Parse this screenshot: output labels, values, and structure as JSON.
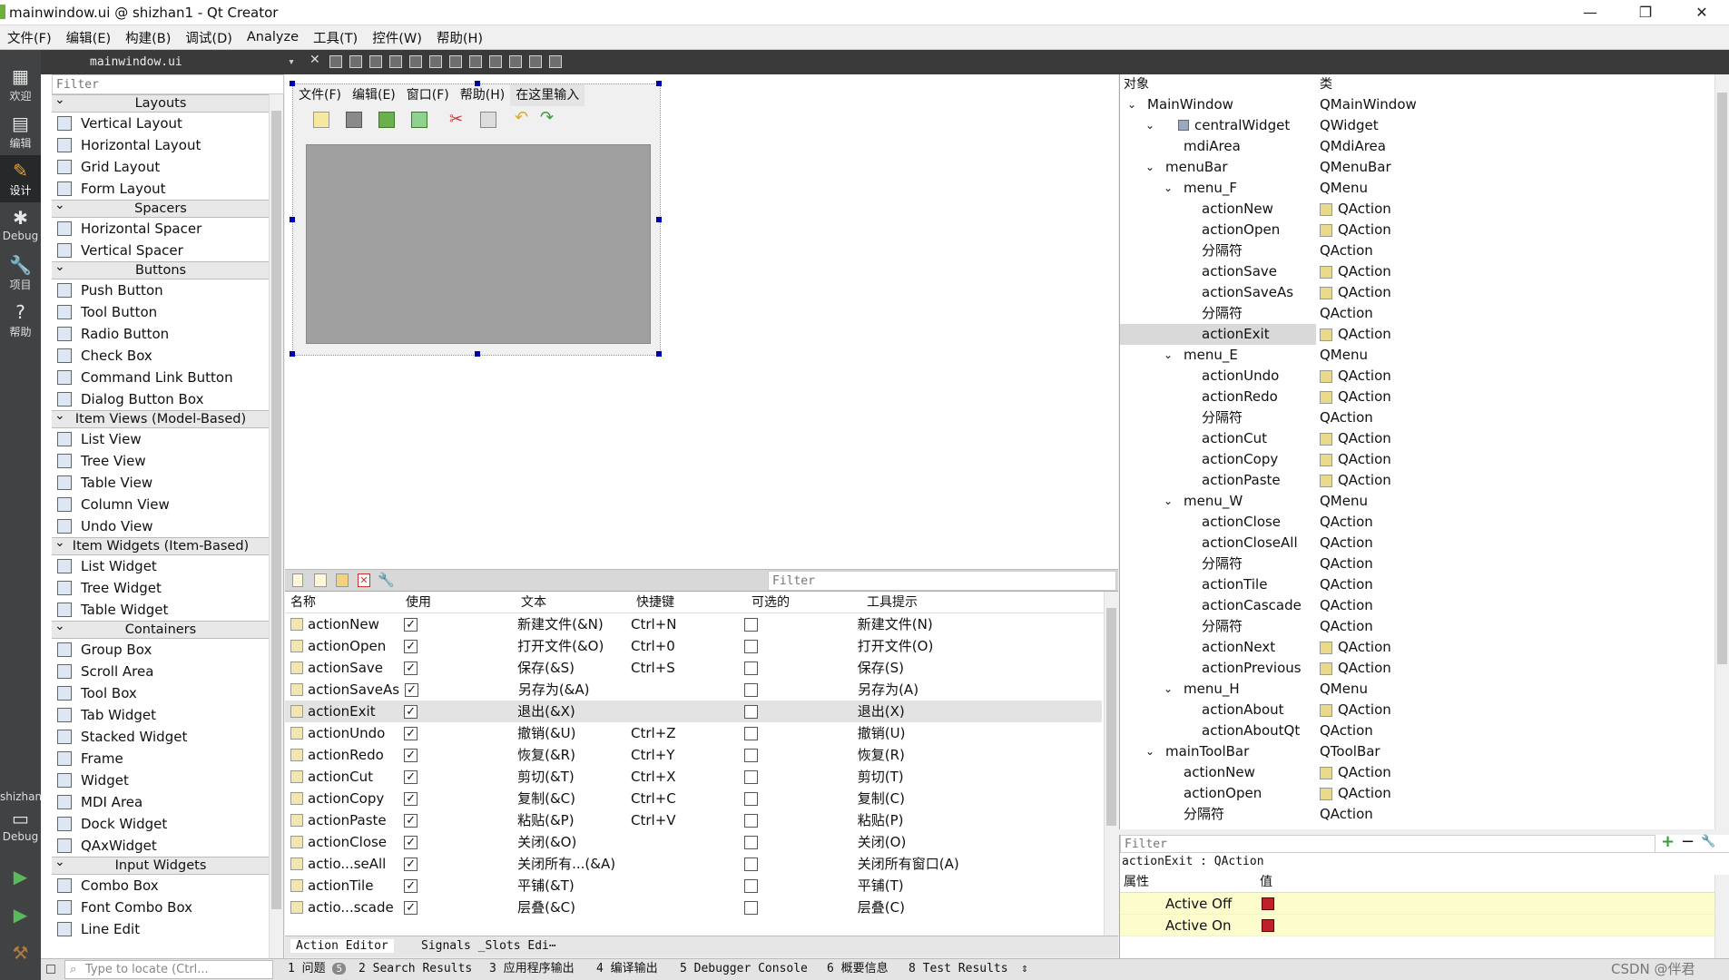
{
  "window": {
    "title": "mainwindow.ui @ shizhan1 - Qt Creator",
    "minimize": "—",
    "maximize": "❐",
    "close": "✕"
  },
  "menubar": [
    "文件(F)",
    "编辑(E)",
    "构建(B)",
    "调试(D)",
    "Analyze",
    "工具(T)",
    "控件(W)",
    "帮助(H)"
  ],
  "modes": [
    {
      "label": "欢迎",
      "icon": "grid-icon"
    },
    {
      "label": "编辑",
      "icon": "edit-icon"
    },
    {
      "label": "设计",
      "icon": "design-icon"
    },
    {
      "label": "Debug",
      "icon": "bug-icon"
    },
    {
      "label": "项目",
      "icon": "wrench-icon"
    },
    {
      "label": "帮助",
      "icon": "help-icon"
    }
  ],
  "kit": {
    "project": "shizhan1",
    "mode": "Debug"
  },
  "editor_tab": {
    "file": "mainwindow.ui"
  },
  "widgetbox": {
    "filter_placeholder": "Filter",
    "categories": [
      {
        "name": "Layouts",
        "items": [
          "Vertical Layout",
          "Horizontal Layout",
          "Grid Layout",
          "Form Layout"
        ]
      },
      {
        "name": "Spacers",
        "items": [
          "Horizontal Spacer",
          "Vertical Spacer"
        ]
      },
      {
        "name": "Buttons",
        "items": [
          "Push Button",
          "Tool Button",
          "Radio Button",
          "Check Box",
          "Command Link Button",
          "Dialog Button Box"
        ]
      },
      {
        "name": "Item Views (Model-Based)",
        "items": [
          "List View",
          "Tree View",
          "Table View",
          "Column View",
          "Undo View"
        ]
      },
      {
        "name": "Item Widgets (Item-Based)",
        "items": [
          "List Widget",
          "Tree Widget",
          "Table Widget"
        ]
      },
      {
        "name": "Containers",
        "items": [
          "Group Box",
          "Scroll Area",
          "Tool Box",
          "Tab Widget",
          "Stacked Widget",
          "Frame",
          "Widget",
          "MDI Area",
          "Dock Widget",
          "QAxWidget"
        ]
      },
      {
        "name": "Input Widgets",
        "items": [
          "Combo Box",
          "Font Combo Box",
          "Line Edit"
        ]
      }
    ]
  },
  "form": {
    "menus": [
      "文件(F)",
      "编辑(E)",
      "窗口(F)",
      "帮助(H)",
      "在这里输入"
    ]
  },
  "action_editor": {
    "filter_placeholder": "Filter",
    "headers": [
      "名称",
      "使用",
      "文本",
      "快捷键",
      "可选的",
      "工具提示"
    ],
    "rows": [
      {
        "name": "actionNew",
        "used": true,
        "text": "新建文件(&N)",
        "shortcut": "Ctrl+N",
        "checkable": false,
        "tooltip": "新建文件(N)"
      },
      {
        "name": "actionOpen",
        "used": true,
        "text": "打开文件(&O)",
        "shortcut": "Ctrl+0",
        "checkable": false,
        "tooltip": "打开文件(O)"
      },
      {
        "name": "actionSave",
        "used": true,
        "text": "保存(&S)",
        "shortcut": "Ctrl+S",
        "checkable": false,
        "tooltip": "保存(S)"
      },
      {
        "name": "actionSaveAs",
        "used": true,
        "text": "另存为(&A)",
        "shortcut": "",
        "checkable": false,
        "tooltip": "另存为(A)"
      },
      {
        "name": "actionExit",
        "used": true,
        "text": "退出(&X)",
        "shortcut": "",
        "checkable": false,
        "tooltip": "退出(X)",
        "selected": true
      },
      {
        "name": "actionUndo",
        "used": true,
        "text": "撤销(&U)",
        "shortcut": "Ctrl+Z",
        "checkable": false,
        "tooltip": "撤销(U)"
      },
      {
        "name": "actionRedo",
        "used": true,
        "text": "恢复(&R)",
        "shortcut": "Ctrl+Y",
        "checkable": false,
        "tooltip": "恢复(R)"
      },
      {
        "name": "actionCut",
        "used": true,
        "text": "剪切(&T)",
        "shortcut": "Ctrl+X",
        "checkable": false,
        "tooltip": "剪切(T)"
      },
      {
        "name": "actionCopy",
        "used": true,
        "text": "复制(&C)",
        "shortcut": "Ctrl+C",
        "checkable": false,
        "tooltip": "复制(C)"
      },
      {
        "name": "actionPaste",
        "used": true,
        "text": "粘贴(&P)",
        "shortcut": "Ctrl+V",
        "checkable": false,
        "tooltip": "粘贴(P)"
      },
      {
        "name": "actionClose",
        "used": true,
        "text": "关闭(&O)",
        "shortcut": "",
        "checkable": false,
        "tooltip": "关闭(O)"
      },
      {
        "name": "actio...seAll",
        "used": true,
        "text": "关闭所有...(&A)",
        "shortcut": "",
        "checkable": false,
        "tooltip": "关闭所有窗口(A)"
      },
      {
        "name": "actionTile",
        "used": true,
        "text": "平铺(&T)",
        "shortcut": "",
        "checkable": false,
        "tooltip": "平铺(T)"
      },
      {
        "name": "actio...scade",
        "used": true,
        "text": "层叠(&C)",
        "shortcut": "",
        "checkable": false,
        "tooltip": "层叠(C)"
      }
    ],
    "tabs": [
      "Action Editor",
      "Signals _Slots Edi⋯"
    ]
  },
  "object_inspector": {
    "headers": [
      "对象",
      "类"
    ],
    "rows": [
      {
        "level": 0,
        "expand": true,
        "name": "MainWindow",
        "cls": "QMainWindow"
      },
      {
        "level": 1,
        "expand": true,
        "name": "centralWidget",
        "cls": "QWidget",
        "iconLeft": true
      },
      {
        "level": 2,
        "name": "mdiArea",
        "cls": "QMdiArea"
      },
      {
        "level": 1,
        "expand": true,
        "name": "menuBar",
        "cls": "QMenuBar"
      },
      {
        "level": 2,
        "expand": true,
        "name": "menu_F",
        "cls": "QMenu"
      },
      {
        "level": 3,
        "name": "actionNew",
        "cls": "QAction",
        "icon": true
      },
      {
        "level": 3,
        "name": "actionOpen",
        "cls": "QAction",
        "icon": true
      },
      {
        "level": 3,
        "name": "分隔符",
        "cls": "QAction"
      },
      {
        "level": 3,
        "name": "actionSave",
        "cls": "QAction",
        "icon": true
      },
      {
        "level": 3,
        "name": "actionSaveAs",
        "cls": "QAction",
        "icon": true
      },
      {
        "level": 3,
        "name": "分隔符",
        "cls": "QAction"
      },
      {
        "level": 3,
        "name": "actionExit",
        "cls": "QAction",
        "icon": true,
        "selected": true
      },
      {
        "level": 2,
        "expand": true,
        "name": "menu_E",
        "cls": "QMenu"
      },
      {
        "level": 3,
        "name": "actionUndo",
        "cls": "QAction",
        "icon": true
      },
      {
        "level": 3,
        "name": "actionRedo",
        "cls": "QAction",
        "icon": true
      },
      {
        "level": 3,
        "name": "分隔符",
        "cls": "QAction"
      },
      {
        "level": 3,
        "name": "actionCut",
        "cls": "QAction",
        "icon": true
      },
      {
        "level": 3,
        "name": "actionCopy",
        "cls": "QAction",
        "icon": true
      },
      {
        "level": 3,
        "name": "actionPaste",
        "cls": "QAction",
        "icon": true
      },
      {
        "level": 2,
        "expand": true,
        "name": "menu_W",
        "cls": "QMenu"
      },
      {
        "level": 3,
        "name": "actionClose",
        "cls": "QAction"
      },
      {
        "level": 3,
        "name": "actionCloseAll",
        "cls": "QAction"
      },
      {
        "level": 3,
        "name": "分隔符",
        "cls": "QAction"
      },
      {
        "level": 3,
        "name": "actionTile",
        "cls": "QAction"
      },
      {
        "level": 3,
        "name": "actionCascade",
        "cls": "QAction"
      },
      {
        "level": 3,
        "name": "分隔符",
        "cls": "QAction"
      },
      {
        "level": 3,
        "name": "actionNext",
        "cls": "QAction",
        "icon": true
      },
      {
        "level": 3,
        "name": "actionPrevious",
        "cls": "QAction",
        "icon": true
      },
      {
        "level": 2,
        "expand": true,
        "name": "menu_H",
        "cls": "QMenu"
      },
      {
        "level": 3,
        "name": "actionAbout",
        "cls": "QAction",
        "icon": true
      },
      {
        "level": 3,
        "name": "actionAboutQt",
        "cls": "QAction"
      },
      {
        "level": 1,
        "expand": true,
        "name": "mainToolBar",
        "cls": "QToolBar"
      },
      {
        "level": 2,
        "name": "actionNew",
        "cls": "QAction",
        "icon": true
      },
      {
        "level": 2,
        "name": "actionOpen",
        "cls": "QAction",
        "icon": true
      },
      {
        "level": 2,
        "name": "分隔符",
        "cls": "QAction"
      }
    ]
  },
  "property_editor": {
    "filter_placeholder": "Filter",
    "object_label": "actionExit : QAction",
    "headers": [
      "属性",
      "值"
    ],
    "rows": [
      {
        "name": "Active Off"
      },
      {
        "name": "Active On"
      }
    ]
  },
  "statusbar": {
    "locate_placeholder": "Type to locate (Ctrl...",
    "items": [
      "1 问题",
      "2 Search Results",
      "3 应用程序输出",
      "4 编译输出",
      "5 Debugger Console",
      "6 概要信息",
      "8 Test Results"
    ],
    "problem_count": "5"
  },
  "watermark": "CSDN @伴君"
}
